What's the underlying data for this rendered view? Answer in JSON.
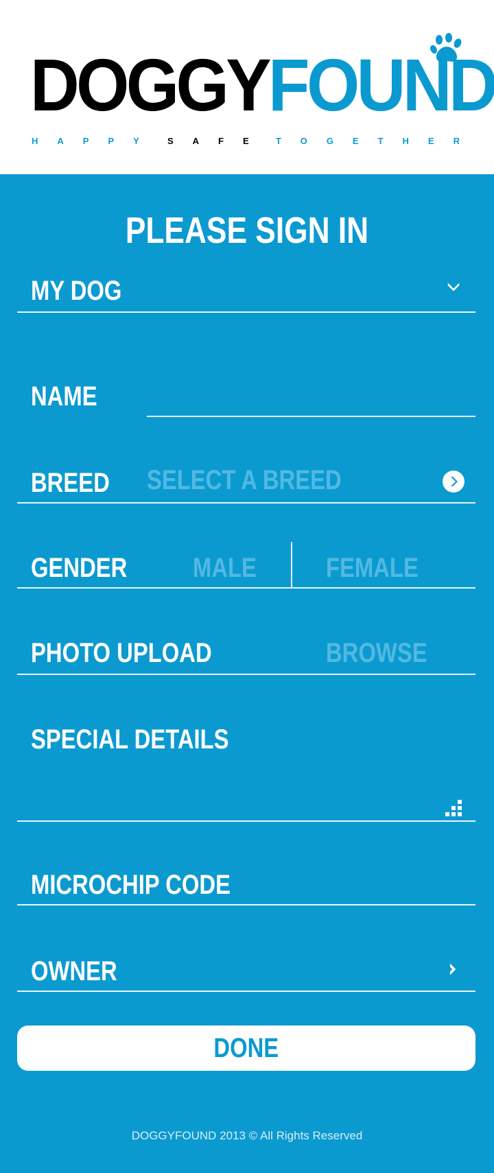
{
  "brand": {
    "name_part1": "DOGGY",
    "name_part2": "FOUND",
    "tagline_1": "HAPPY",
    "tagline_2": "SAFE",
    "tagline_3": "TOGETHER",
    "primary_color": "#0b9ad0",
    "logo_dark_color": "#000000"
  },
  "form": {
    "title": "PLEASE SIGN IN",
    "my_dog": {
      "label": "MY DOG",
      "icon": "chevron-down-icon"
    },
    "name": {
      "label": "NAME",
      "value": ""
    },
    "breed": {
      "label": "BREED",
      "placeholder": "SELECT A BREED",
      "icon": "arrow-right-circle-icon"
    },
    "gender": {
      "label": "GENDER",
      "option_male": "MALE",
      "option_female": "FEMALE"
    },
    "photo": {
      "label": "PHOTO UPLOAD",
      "browse": "BROWSE"
    },
    "special_details": {
      "label": "SPECIAL DETAILS",
      "value": "",
      "icon": "resize-grip-icon"
    },
    "microchip": {
      "label": "MICROCHIP CODE",
      "value": ""
    },
    "owner": {
      "label": "OWNER",
      "icon": "chevron-right-icon"
    },
    "done_label": "DONE"
  },
  "footer": {
    "text": "DOGGYFOUND 2013 © All Rights Reserved"
  }
}
